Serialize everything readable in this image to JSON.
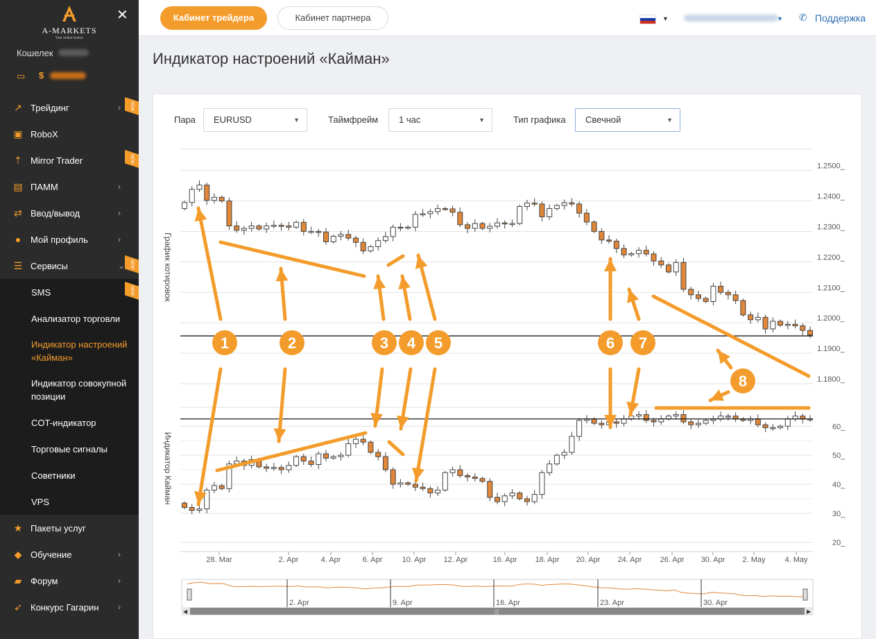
{
  "sidebar": {
    "logo_text": "A-MARKETS",
    "logo_tagline": "Your online broker",
    "wallet_label": "Кошелек",
    "balance_currency": "$",
    "items": [
      {
        "label": "Трейдинг",
        "icon": "trend-icon",
        "chevron": true,
        "new": true
      },
      {
        "label": "RoboX",
        "icon": "robot-icon",
        "chevron": false,
        "new": false
      },
      {
        "label": "Mirror Trader",
        "icon": "arrows-icon",
        "chevron": false,
        "new": true
      },
      {
        "label": "ПАММ",
        "icon": "briefcase-icon",
        "chevron": true,
        "new": false
      },
      {
        "label": "Ввод/вывод",
        "icon": "transfer-icon",
        "chevron": true,
        "new": false
      },
      {
        "label": "Мой профиль",
        "icon": "user-icon",
        "chevron": true,
        "new": false
      },
      {
        "label": "Сервисы",
        "icon": "sliders-icon",
        "chevron": true,
        "new": true
      }
    ],
    "sub_items": [
      {
        "label": "SMS",
        "new": true,
        "active": false
      },
      {
        "label": "Анализатор торговли",
        "new": false,
        "active": false
      },
      {
        "label": "Индикатор настроений «Кайман»",
        "new": false,
        "active": true
      },
      {
        "label": "Индикатор совокупной позиции",
        "new": false,
        "active": false
      },
      {
        "label": "COT-индикатор",
        "new": false,
        "active": false
      },
      {
        "label": "Торговые сигналы",
        "new": false,
        "active": false
      },
      {
        "label": "Советники",
        "new": false,
        "active": false
      },
      {
        "label": "VPS",
        "new": false,
        "active": false
      }
    ],
    "bottom_items": [
      {
        "label": "Пакеты услуг",
        "icon": "star-icon",
        "chevron": false
      },
      {
        "label": "Обучение",
        "icon": "graduation-icon",
        "chevron": true
      },
      {
        "label": "Форум",
        "icon": "chat-icon",
        "chevron": true
      },
      {
        "label": "Конкурс Гагарин",
        "icon": "rocket-icon",
        "chevron": true
      }
    ],
    "new_badge": "NEW"
  },
  "topbar": {
    "trader_cabinet": "Кабинет трейдера",
    "partner_cabinet": "Кабинет партнера",
    "support": "Поддержка"
  },
  "page": {
    "title": "Индикатор настроений «Кайман»"
  },
  "filters": {
    "pair_label": "Пара",
    "pair_value": "EURUSD",
    "timeframe_label": "Таймфрейм",
    "timeframe_value": "1 час",
    "chart_type_label": "Тип графика",
    "chart_type_value": "Свечной"
  },
  "chart_data": [
    {
      "type": "candlestick",
      "ylabel": "График котировок",
      "y_ticks": [
        "1.2500",
        "1.2400",
        "1.2300",
        "1.2200",
        "1.2100",
        "1.2000",
        "1.1900",
        "1.1800"
      ],
      "ylim": [
        1.175,
        1.257
      ],
      "reference_line": 1.1957,
      "close": [
        1.2395,
        1.2438,
        1.2452,
        1.2402,
        1.2412,
        1.24,
        1.2318,
        1.2304,
        1.231,
        1.2318,
        1.2308,
        1.2318,
        1.232,
        1.2318,
        1.2314,
        1.233,
        1.23,
        1.23,
        1.2298,
        1.2266,
        1.2284,
        1.229,
        1.2278,
        1.2264,
        1.2236,
        1.225,
        1.227,
        1.2283,
        1.2314,
        1.2312,
        1.2314,
        1.2356,
        1.2358,
        1.2365,
        1.2375,
        1.2374,
        1.2363,
        1.2322,
        1.231,
        1.2326,
        1.231,
        1.2317,
        1.2328,
        1.2325,
        1.2326,
        1.2382,
        1.2393,
        1.239,
        1.2348,
        1.2375,
        1.2385,
        1.2394,
        1.239,
        1.236,
        1.2331,
        1.23,
        1.2272,
        1.2268,
        1.2244,
        1.2223,
        1.2227,
        1.2238,
        1.2226,
        1.2203,
        1.219,
        1.2167,
        1.2198,
        1.211,
        1.2092,
        1.208,
        1.207,
        1.212,
        1.21,
        1.2092,
        1.2073,
        1.2026,
        1.201,
        1.2018,
        1.198,
        1.2005,
        1.1992,
        1.1995,
        1.199,
        1.1975,
        1.196
      ]
    },
    {
      "type": "candlestick",
      "ylabel": "Индикатор Кайман",
      "y_ticks": [
        "60",
        "50",
        "40",
        "30",
        "20"
      ],
      "ylim": [
        18,
        67
      ],
      "reference_line": 62.5,
      "x_ticks": [
        "28. Mar",
        "2. Apr",
        "4. Apr",
        "6. Apr",
        "10. Apr",
        "12. Apr",
        "16. Apr",
        "18. Apr",
        "20. Apr",
        "24. Apr",
        "26. Apr",
        "30. Apr",
        "2. May",
        "4. May"
      ],
      "close": [
        32,
        31,
        31.5,
        38,
        39.5,
        38.5,
        47,
        48,
        46.5,
        48.5,
        46,
        45.5,
        45.8,
        45,
        46.5,
        49.5,
        48,
        46.8,
        50.5,
        49,
        49.5,
        50,
        54,
        55.5,
        54.5,
        51,
        49.5,
        45,
        40,
        40.5,
        40,
        39,
        38.5,
        37,
        38,
        44,
        45,
        43,
        42.5,
        42,
        41,
        35.5,
        34,
        36,
        37,
        35,
        34,
        36.5,
        44,
        47,
        50,
        51,
        56.5,
        62,
        62.5,
        61,
        60.5,
        61.5,
        61,
        62.5,
        63.5,
        64,
        62,
        61.5,
        62.5,
        63.5,
        64,
        61.5,
        60.5,
        61,
        62,
        62.5,
        63.5,
        63.5,
        62.5,
        62,
        62.5,
        60.5,
        59.5,
        59.5,
        60,
        62.5,
        63.5,
        62.5,
        62.5
      ]
    }
  ],
  "navigator": {
    "labels": [
      "2. Apr",
      "9. Apr",
      "16. Apr",
      "23. Apr",
      "30. Apr"
    ]
  },
  "annotations": [
    "1",
    "2",
    "3",
    "4",
    "5",
    "6",
    "7",
    "8"
  ],
  "colors": {
    "accent": "#f39c2b",
    "sidebar_bg": "#2b2b2b",
    "link": "#2f6fb3",
    "bull_candle": "#ffffff",
    "bear_candle": "#e0873a"
  }
}
